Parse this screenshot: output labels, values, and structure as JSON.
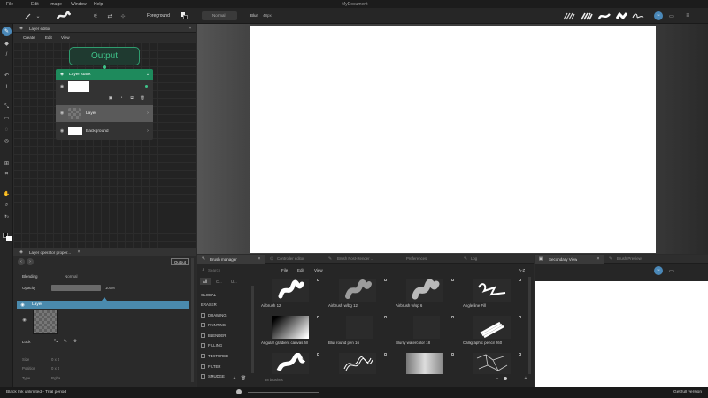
{
  "app": {
    "title": "MyDocument"
  },
  "menu": [
    "File",
    "Edit",
    "Image",
    "Window",
    "Help"
  ],
  "toolbar": {
    "foreground_label": "Foreground",
    "blend_mode": "Normal",
    "blur_label": "Blur",
    "blur_value": "48px"
  },
  "layer_editor": {
    "tab_title": "Layer editor",
    "menu": [
      "Create",
      "Edit",
      "View"
    ],
    "output_label": "Output",
    "stack_title": "Layer stack",
    "layers": [
      "Layer",
      "Background"
    ]
  },
  "layer_props": {
    "tab_title": "Layer operator proper...",
    "output_button": "Output",
    "blending_label": "Blending",
    "blending_value": "Normal",
    "opacity_label": "Opacity",
    "opacity_value": "100%",
    "opacity_fraction": 1.0,
    "layer_name": "Layer",
    "lock_label": "Lock",
    "size_label": "Size",
    "size_value": "0 x 0",
    "position_label": "Position",
    "position_value": "0 x 0",
    "type_label": "Type",
    "type_value": "Rgba"
  },
  "brush_manager": {
    "tabs": [
      "Brush manager",
      "Controller editor",
      "Brush Post-Render ...",
      "Preferences",
      "Log"
    ],
    "search_placeholder": "Search",
    "menu": [
      "File",
      "Edit",
      "View"
    ],
    "filter_chips": [
      "All",
      "C...",
      "U..."
    ],
    "categories": [
      "GLOBAL",
      "ERASER",
      "DRAWING",
      "PAINTING",
      "BLENDER",
      "FILLING",
      "TEXTURED",
      "FILTER",
      "SMUDGE"
    ],
    "brushes": [
      "Airbrush 12",
      "Airbrush w/bg 12",
      "Airbrush w/sp 6",
      "Angle line Fill",
      "Angular gradient canvas fill",
      "Blur round pen 16",
      "Blurry watercolor 18",
      "Calligraphic pencil 260",
      "",
      "",
      "",
      ""
    ],
    "count_label": "88 brushes",
    "sort_label": "A-Z"
  },
  "secondary_view": {
    "tabs": [
      "Secondary View",
      "Brush Preview"
    ]
  },
  "status": {
    "left": "Black Ink unlimited - Trial period",
    "right": "Get full version"
  }
}
